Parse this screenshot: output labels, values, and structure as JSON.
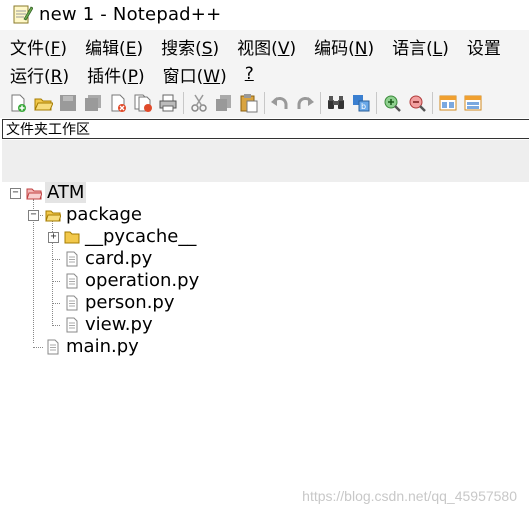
{
  "window": {
    "title": "new 1 - Notepad++"
  },
  "menu": {
    "row1": [
      {
        "label": "文件(",
        "acc": "F",
        "end": ")"
      },
      {
        "label": "编辑(",
        "acc": "E",
        "end": ")"
      },
      {
        "label": "搜索(",
        "acc": "S",
        "end": ")"
      },
      {
        "label": "视图(",
        "acc": "V",
        "end": ")"
      },
      {
        "label": "编码(",
        "acc": "N",
        "end": ")"
      },
      {
        "label": "语言(",
        "acc": "L",
        "end": ")"
      },
      {
        "label": "设置",
        "acc": "",
        "end": ""
      }
    ],
    "row2": [
      {
        "label": "运行(",
        "acc": "R",
        "end": ")"
      },
      {
        "label": "插件(",
        "acc": "P",
        "end": ")"
      },
      {
        "label": "窗口(",
        "acc": "W",
        "end": ")"
      },
      {
        "label": "",
        "acc": "?",
        "end": ""
      }
    ]
  },
  "toolbar": {
    "icons": [
      "new-file-icon",
      "open-folder-icon",
      "save-icon",
      "save-all-icon",
      "close-icon",
      "close-all-icon",
      "print-icon",
      "cut-icon",
      "copy-icon",
      "paste-icon",
      "undo-icon",
      "redo-icon",
      "find-icon",
      "replace-icon",
      "zoom-in-icon",
      "zoom-out-icon",
      "sync-vertical-icon",
      "sync-horizontal-icon"
    ]
  },
  "panel": {
    "title": "文件夹工作区"
  },
  "tree": {
    "root": "ATM",
    "package": "package",
    "pycache": "__pycache__",
    "files_in_package": [
      "card.py",
      "operation.py",
      "person.py",
      "view.py"
    ],
    "main": "main.py"
  },
  "watermark": "https://blog.csdn.net/qq_45957580",
  "colors": {
    "folder": "#f2c84b",
    "project": "#e05a5a",
    "selected": "#e4e4e4"
  }
}
